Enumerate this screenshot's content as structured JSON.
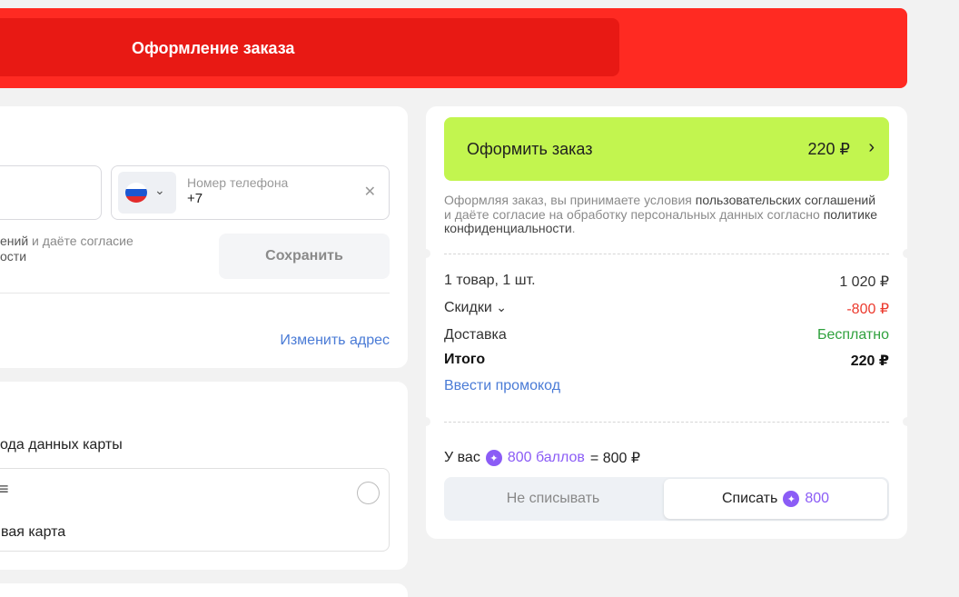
{
  "header": {
    "title": "Оформление заказа"
  },
  "contact": {
    "phone_label": "Номер телефона",
    "phone_value": "+7",
    "consent_line1": "ений",
    "consent_line1_rest": " и даёте согласие",
    "consent_line2": "ости",
    "save_label": "Сохранить",
    "change_address": "Изменить адрес"
  },
  "payment": {
    "text_fragment": "ода данных карты",
    "card_name": "вая карта"
  },
  "summary": {
    "order_button_label": "Оформить заказ",
    "order_button_total": "220 ₽",
    "terms": {
      "t1": "Оформляя заказ, вы принимаете условия ",
      "t2": "пользовательских соглашений",
      "t3": " и даёте согласие на обработку персональных данных согласно ",
      "t4": "политике конфиденциальности",
      "t5": "."
    },
    "items_label": "1 товар, 1 шт.",
    "items_value": "1 020 ₽",
    "discounts_label": "Скидки",
    "discounts_value": "-800 ₽",
    "delivery_label": "Доставка",
    "delivery_value": "Бесплатно",
    "total_label": "Итого",
    "total_value": "220 ₽",
    "promo_label": "Ввести промокод",
    "points_prefix": "У вас",
    "points_link": "800 баллов",
    "points_suffix": "= 800 ₽",
    "no_spend_label": "Не списывать",
    "spend_label": "Списать",
    "spend_amount": "800"
  },
  "colors": {
    "header": "#ff2a22",
    "order_button": "#c2f54f",
    "discount": "#ec3a2e",
    "delivery": "#2fa13d",
    "link": "#4a7bd6",
    "points": "#8b5cf6"
  }
}
